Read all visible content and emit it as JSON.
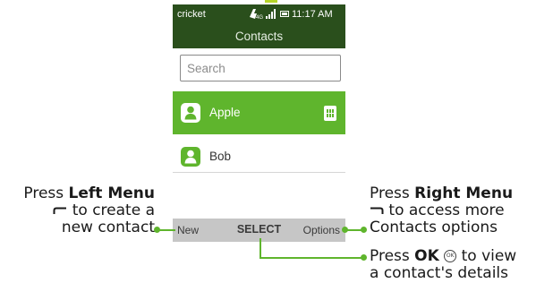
{
  "status_bar": {
    "carrier": "cricket",
    "signal_icons": "signal-4g-icon",
    "battery_icon": "battery-icon",
    "time": "11:17 AM"
  },
  "header": {
    "title": "Contacts"
  },
  "search": {
    "placeholder": "Search",
    "value": ""
  },
  "contacts": [
    {
      "name": "Apple",
      "selected": true,
      "icon": "contact-avatar-icon",
      "badge_icon": "sim-card-icon"
    },
    {
      "name": "Bob",
      "selected": false,
      "icon": "contact-avatar-icon"
    }
  ],
  "softkeys": {
    "left": "New",
    "center": "SELECT",
    "right": "Options"
  },
  "callouts": {
    "left": {
      "line1_prefix": "Press ",
      "line1_bold": "Left Menu",
      "line2": "to create a",
      "line3": "new contact",
      "key_icon": "left-softkey-icon"
    },
    "right": {
      "line1_prefix": "Press ",
      "line1_bold": "Right Menu",
      "line2": "to access more",
      "line3": "Contacts options",
      "key_icon": "right-softkey-icon"
    },
    "ok": {
      "line1_prefix": "Press ",
      "line1_bold": "OK",
      "line1_suffix": "to view",
      "line2": "a contact's details",
      "key_icon": "ok-key-icon",
      "key_glyph": "OK"
    }
  },
  "colors": {
    "header_bg": "#2a4f1c",
    "accent_green": "#5fb52d",
    "softkey_bar": "#c6c6c6"
  }
}
